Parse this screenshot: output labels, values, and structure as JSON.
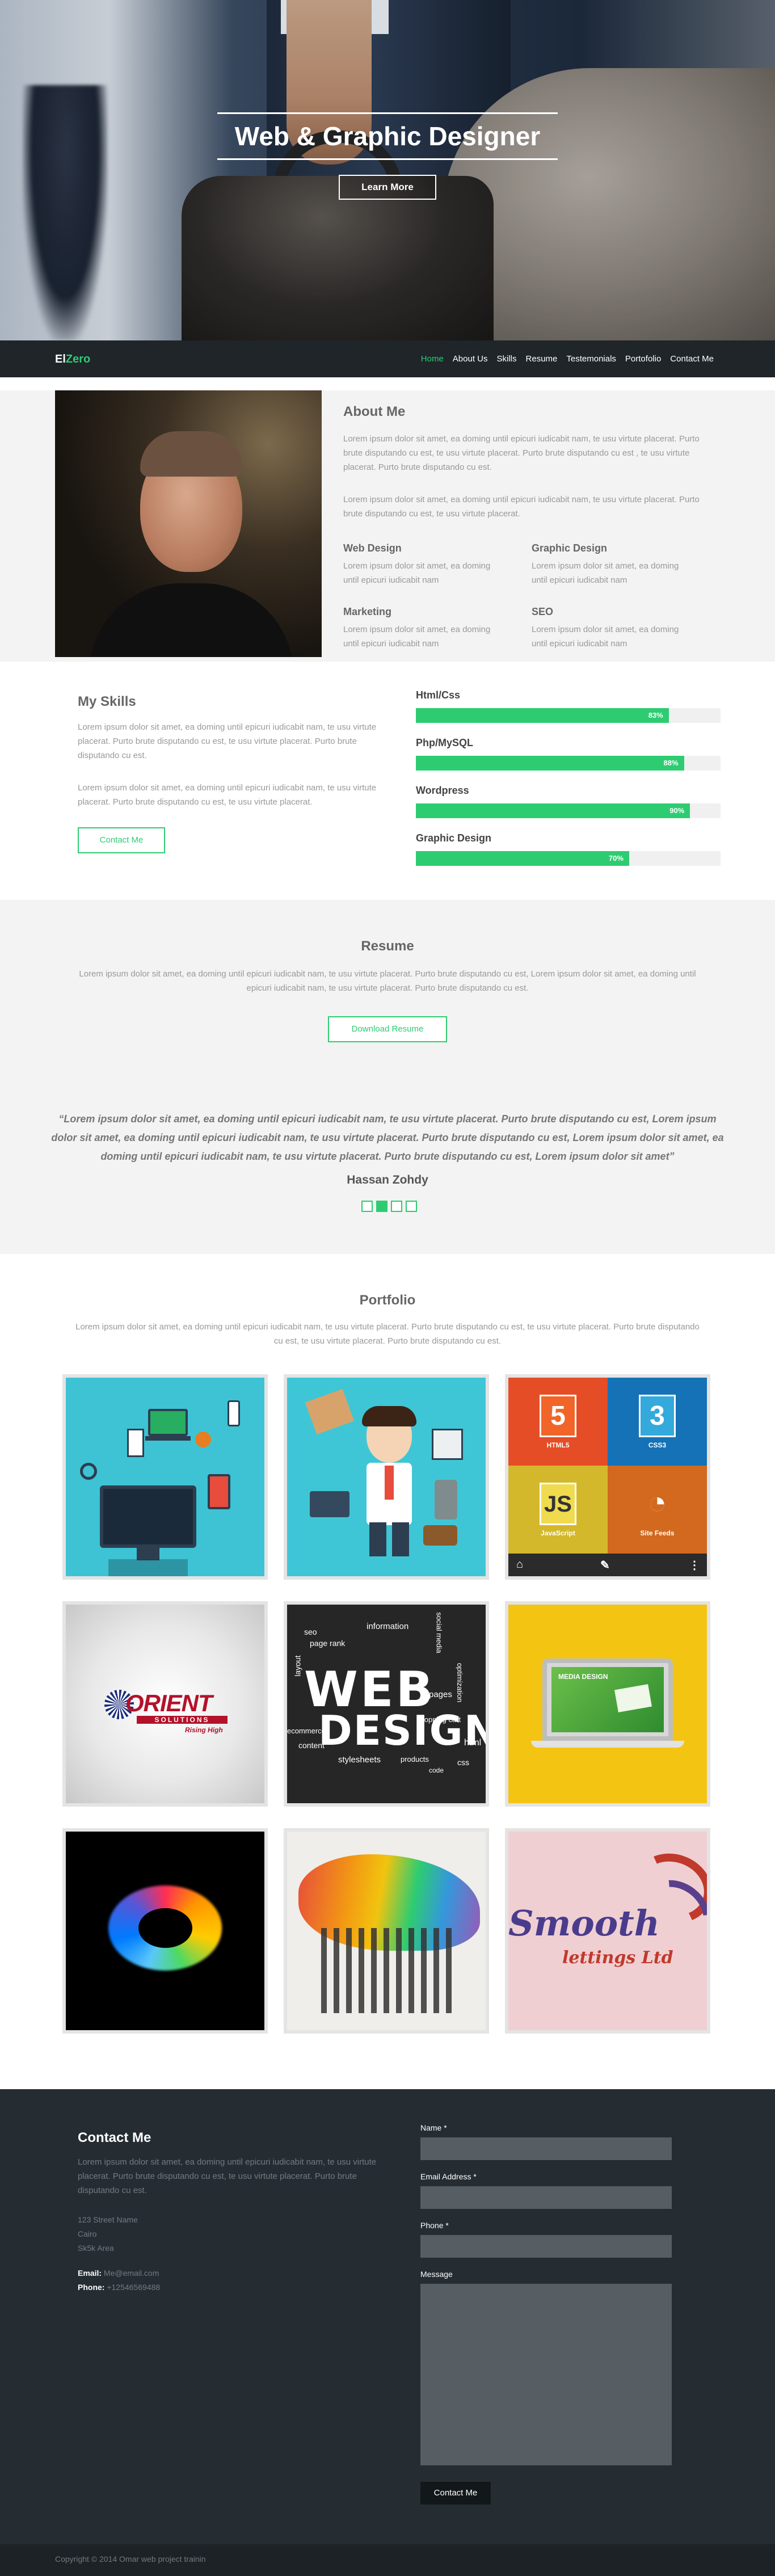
{
  "hero": {
    "title": "Web & Graphic Designer",
    "button": "Learn More"
  },
  "nav": {
    "logo_a": "El",
    "logo_b": "Zero",
    "items": [
      "Home",
      "About Us",
      "Skills",
      "Resume",
      "Testemonials",
      "Portofolio",
      "Contact Me"
    ],
    "active": "Home"
  },
  "about": {
    "title": "About Me",
    "p1": "Lorem ipsum dolor sit amet, ea doming until epicuri iudicabit nam, te usu virtute placerat. Purto brute disputando cu est, te usu virtute placerat. Purto brute disputando cu est , te usu virtute placerat. Purto brute disputando cu est.",
    "p2": "Lorem ipsum dolor sit amet, ea doming until epicuri iudicabit nam, te usu virtute placerat. Purto brute disputando cu est, te usu virtute placerat.",
    "services": [
      {
        "title": "Web Design",
        "text": "Lorem ipsum dolor sit amet, ea doming until epicuri iudicabit nam"
      },
      {
        "title": "Graphic Design",
        "text": "Lorem ipsum dolor sit amet, ea doming until epicuri iudicabit nam"
      },
      {
        "title": "Marketing",
        "text": "Lorem ipsum dolor sit amet, ea doming until epicuri iudicabit nam"
      },
      {
        "title": "SEO",
        "text": "Lorem ipsum dolor sit amet, ea doming until epicuri iudicabit nam"
      }
    ]
  },
  "skills": {
    "title": "My Skills",
    "p1": "Lorem ipsum dolor sit amet, ea doming until epicuri iudicabit nam, te usu virtute placerat. Purto brute disputando cu est, te usu virtute placerat. Purto brute disputando cu est.",
    "p2": "Lorem ipsum dolor sit amet, ea doming until epicuri iudicabit nam, te usu virtute placerat. Purto brute disputando cu est, te usu virtute placerat.",
    "button": "Contact Me",
    "items": [
      {
        "name": "Html/Css",
        "label": "83%",
        "percent": 83
      },
      {
        "name": "Php/MySQL",
        "label": "88%",
        "percent": 88
      },
      {
        "name": "Wordpress",
        "label": "90%",
        "percent": 90
      },
      {
        "name": "Graphic Design",
        "label": "70%",
        "percent": 70
      }
    ],
    "bar_color": "#2ecc71"
  },
  "resume": {
    "title": "Resume",
    "text": "Lorem ipsum dolor sit amet, ea doming until epicuri iudicabit nam, te usu virtute placerat. Purto brute disputando cu est, Lorem ipsum dolor sit amet, ea doming until epicuri iudicabit nam, te usu virtute placerat. Purto brute disputando cu est.",
    "button": "Download Resume"
  },
  "testimonial": {
    "quote": "“Lorem ipsum dolor sit amet, ea doming until epicuri iudicabit nam, te usu virtute placerat. Purto brute disputando cu est, Lorem ipsum dolor sit amet, ea doming until epicuri iudicabit nam, te usu virtute placerat. Purto brute disputando cu est, Lorem ipsum dolor sit amet, ea doming until epicuri iudicabit nam, te usu virtute placerat. Purto brute disputando cu est, Lorem ipsum dolor sit amet”",
    "author": "Hassan Zohdy",
    "active_dot": 2
  },
  "portfolio": {
    "title": "Portfolio",
    "text": "Lorem ipsum dolor sit amet, ea doming until epicuri iudicabit nam, te usu virtute placerat. Purto brute disputando cu est, te usu virtute placerat. Purto brute disputando cu est, te usu virtute placerat. Purto brute disputando cu est.",
    "tile3": {
      "html": "HTML5",
      "css": "CSS3",
      "js": "JavaScript",
      "rss": "Site Feeds"
    },
    "tile4": {
      "brand": "ORIENT",
      "sub": "SOLUTIONS",
      "tag": "Rising High"
    },
    "tile5": {
      "line1": "WEB",
      "line2": "DESIGN",
      "words": [
        "seo",
        "page rank",
        "information",
        "social media",
        "layout",
        "pages",
        "optimization",
        "ecommerce",
        "content",
        "shopping cart",
        "html",
        "css",
        "stylesheets",
        "products",
        "code"
      ]
    },
    "tile6": {
      "title": "MEDIA DESIGN"
    },
    "tile9": {
      "brand": "Smooth",
      "sub": "lettings Ltd"
    }
  },
  "contact": {
    "title": "Contact Me",
    "text": "Lorem ipsum dolor sit amet, ea doming until epicuri iudicabit nam, te usu virtute placerat. Purto brute disputando cu est, te usu virtute placerat. Purto brute disputando cu est.",
    "address": [
      "123 Street Name",
      "Cairo",
      "Sk5k Area"
    ],
    "email_label": "Email:",
    "email": "Me@email.com",
    "phone_label": "Phone:",
    "phone": "+12546569488",
    "form": {
      "name": "Name *",
      "email": "Email Address *",
      "phone": "Phone *",
      "message": "Message",
      "send": "Contact Me"
    }
  },
  "footer": {
    "text": "Copyright © 2014 Omar web project trainin"
  }
}
